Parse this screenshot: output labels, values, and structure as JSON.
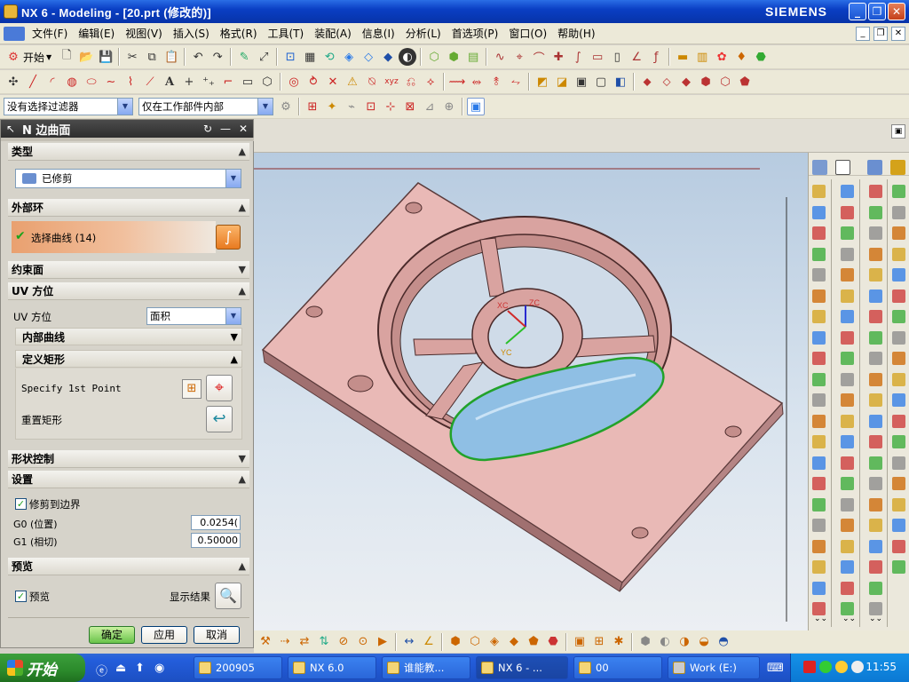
{
  "window": {
    "title": "NX 6 - Modeling - [20.prt (修改的)]",
    "brand": "SIEMENS"
  },
  "menu": [
    "文件(F)",
    "编辑(E)",
    "视图(V)",
    "插入(S)",
    "格式(R)",
    "工具(T)",
    "装配(A)",
    "信息(I)",
    "分析(L)",
    "首选项(P)",
    "窗口(O)",
    "帮助(H)"
  ],
  "toolbar": {
    "start_label": "开始",
    "filter_value": "没有选择过滤器",
    "scope_value": "仅在工作部件内部"
  },
  "dialog": {
    "title": "N 边曲面",
    "type_section": "类型",
    "type_value": "已修剪",
    "outer_loop_section": "外部环",
    "select_curve": "选择曲线 (14)",
    "constraint_section": "约束面",
    "uv_section": "UV 方位",
    "uv_label": "UV 方位",
    "uv_value": "面积",
    "inner_curve": "内部曲线",
    "define_rect": "定义矩形",
    "specify_point": "Specify 1st Point",
    "reset_rect": "重置矩形",
    "shape_control": "形状控制",
    "settings_section": "设置",
    "trim_to_boundary": "修剪到边界",
    "g0_label": "G0 (位置)",
    "g0_value": "0.0254(",
    "g1_label": "G1 (相切)",
    "g1_value": "0.50000",
    "preview_section": "预览",
    "preview_label": "预览",
    "show_result": "显示结果",
    "ok": "确定",
    "apply": "应用",
    "cancel": "取消"
  },
  "viewport": {
    "xc": "XC",
    "yc": "YC",
    "zc": "ZC"
  },
  "taskbar": {
    "start": "开始",
    "tasks": [
      "200905",
      "NX 6.0",
      "谁能教...",
      "NX 6 - ...",
      "00",
      "Work (E:)"
    ],
    "clock": "11:55"
  }
}
